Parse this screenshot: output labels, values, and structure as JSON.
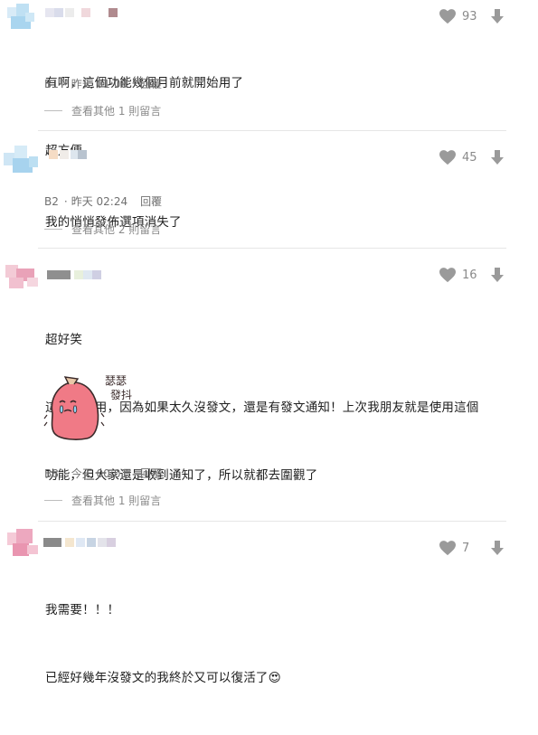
{
  "comments": [
    {
      "likes": "93",
      "lines": [
        "有啊，這個功能幾個月前就開始用了",
        "超方便"
      ],
      "floor": "B1",
      "time": "昨天 01:08",
      "reply": "回覆",
      "more": "查看其他 1 則留言"
    },
    {
      "likes": "45",
      "lines": [
        "我的悄悄發佈選項消失了"
      ],
      "floor": "B2",
      "time": "昨天 02:24",
      "reply": "回覆",
      "more": "查看其他 2 則留言"
    },
    {
      "likes": "16",
      "title": "超好笑",
      "lines": [
        "這個沒有用，因為如果太久沒發文，還是有發文通知！上次我朋友就是使用這個",
        "功能，但大家還是收到通知了，所以就都去圍觀了"
      ],
      "sticker_text": "瑟瑟\n發抖",
      "floor": "B8",
      "time": "今天 00:01",
      "reply": "回覆",
      "more": "查看其他 1 則留言"
    },
    {
      "likes": "7",
      "lines": [
        "我需要！！！",
        "已經好幾年沒發文的我終於又可以復活了😍"
      ]
    }
  ],
  "colors": {
    "icon": "#9a9a9a",
    "sticker_body": "#f07a86",
    "sticker_outline": "#3a2a2a"
  }
}
